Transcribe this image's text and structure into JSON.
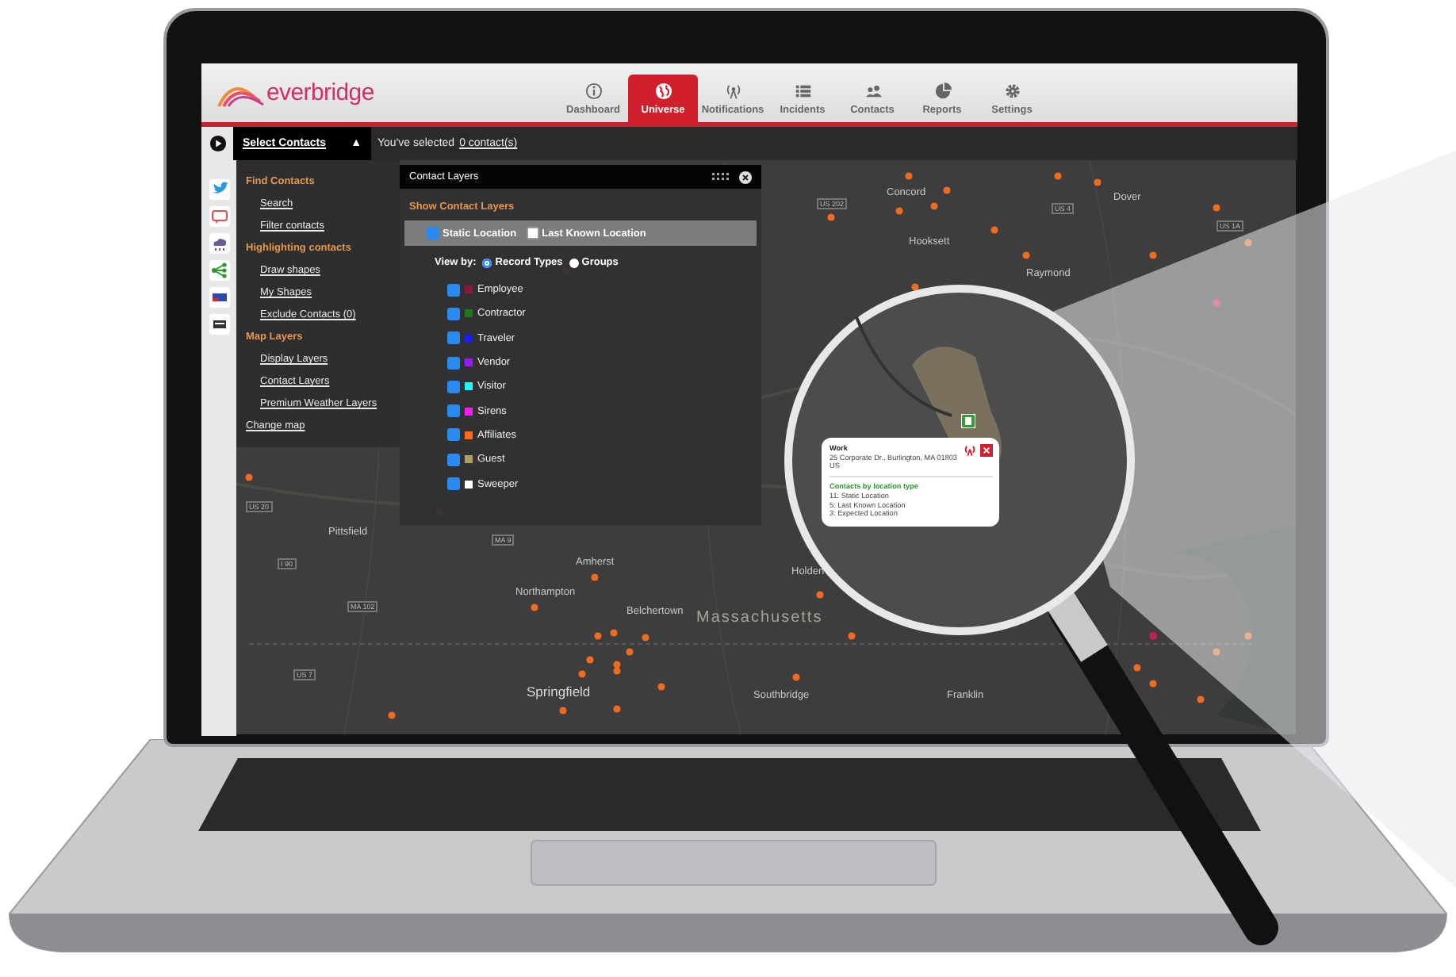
{
  "header": {
    "logo": "everbridge",
    "nav": [
      {
        "label": "Dashboard",
        "selected": false
      },
      {
        "label": "Universe",
        "selected": true
      },
      {
        "label": "Notifications",
        "selected": false
      },
      {
        "label": "Incidents",
        "selected": false
      },
      {
        "label": "Contacts",
        "selected": false
      },
      {
        "label": "Reports",
        "selected": false
      },
      {
        "label": "Settings",
        "selected": false
      }
    ]
  },
  "toolbar": {
    "select_contacts": "Select Contacts",
    "caret": "▲",
    "selection_text": "You've selected",
    "selection_link": "0 contact(s)"
  },
  "sidebar": {
    "sections": [
      {
        "heading": "Find Contacts",
        "items": [
          "Search",
          "Filter contacts"
        ]
      },
      {
        "heading": "Highlighting contacts",
        "items": [
          "Draw shapes",
          "My Shapes",
          "Exclude Contacts (0)"
        ]
      },
      {
        "heading": "Map Layers",
        "items": [
          "Display Layers",
          "Contact Layers",
          "Premium Weather Layers"
        ]
      }
    ],
    "footer_link": "Change map"
  },
  "contact_layers": {
    "title": "Contact Layers",
    "section": "Show Contact Layers",
    "locations": [
      {
        "label": "Static Location",
        "checked": true
      },
      {
        "label": "Last Known Location",
        "checked": false
      }
    ],
    "view_by": {
      "label": "View by:",
      "options": [
        {
          "label": "Record Types",
          "selected": true
        },
        {
          "label": "Groups",
          "selected": false
        }
      ]
    },
    "record_types": [
      {
        "label": "Employee",
        "checked": true,
        "color": "#8b1a3a"
      },
      {
        "label": "Contractor",
        "checked": true,
        "color": "#1a7a1a"
      },
      {
        "label": "Traveler",
        "checked": true,
        "color": "#1a1aff"
      },
      {
        "label": "Vendor",
        "checked": true,
        "color": "#9a1aff"
      },
      {
        "label": "Visitor",
        "checked": true,
        "color": "#1affff"
      },
      {
        "label": "Sirens",
        "checked": true,
        "color": "#ff1aff"
      },
      {
        "label": "Affiliates",
        "checked": true,
        "color": "#ff6a1a"
      },
      {
        "label": "Guest",
        "checked": true,
        "color": "#b0a060"
      },
      {
        "label": "Sweeper",
        "checked": true,
        "color": "#ffffff"
      }
    ]
  },
  "map": {
    "labels": [
      {
        "text": "Concord",
        "kind": "city"
      },
      {
        "text": "Dover",
        "kind": "city"
      },
      {
        "text": "Hooksett",
        "kind": "city"
      },
      {
        "text": "Raymond",
        "kind": "city"
      },
      {
        "text": "US 202",
        "kind": "road"
      },
      {
        "text": "US 4",
        "kind": "road"
      },
      {
        "text": "US 1A",
        "kind": "road"
      },
      {
        "text": "Pittsfield",
        "kind": "city"
      },
      {
        "text": "Amherst",
        "kind": "city"
      },
      {
        "text": "Northampton",
        "kind": "city"
      },
      {
        "text": "Belchertown",
        "kind": "city"
      },
      {
        "text": "Holden",
        "kind": "city"
      },
      {
        "text": "Massachusetts",
        "kind": "region"
      },
      {
        "text": "Springfield",
        "kind": "bigcity"
      },
      {
        "text": "Southbridge",
        "kind": "city"
      },
      {
        "text": "Franklin",
        "kind": "city"
      },
      {
        "text": "US 20",
        "kind": "road"
      },
      {
        "text": "I 90",
        "kind": "road"
      },
      {
        "text": "MA 9",
        "kind": "road"
      },
      {
        "text": "MA 102",
        "kind": "road"
      },
      {
        "text": "US 7",
        "kind": "road"
      }
    ]
  },
  "popup": {
    "title": "Work",
    "address": "25 Corporate Dr., Burlington, MA 01803 US",
    "section": "Contacts by location type",
    "lines": [
      "11: Static Location",
      "5: Last Known Location",
      "3: Expected Location"
    ]
  }
}
